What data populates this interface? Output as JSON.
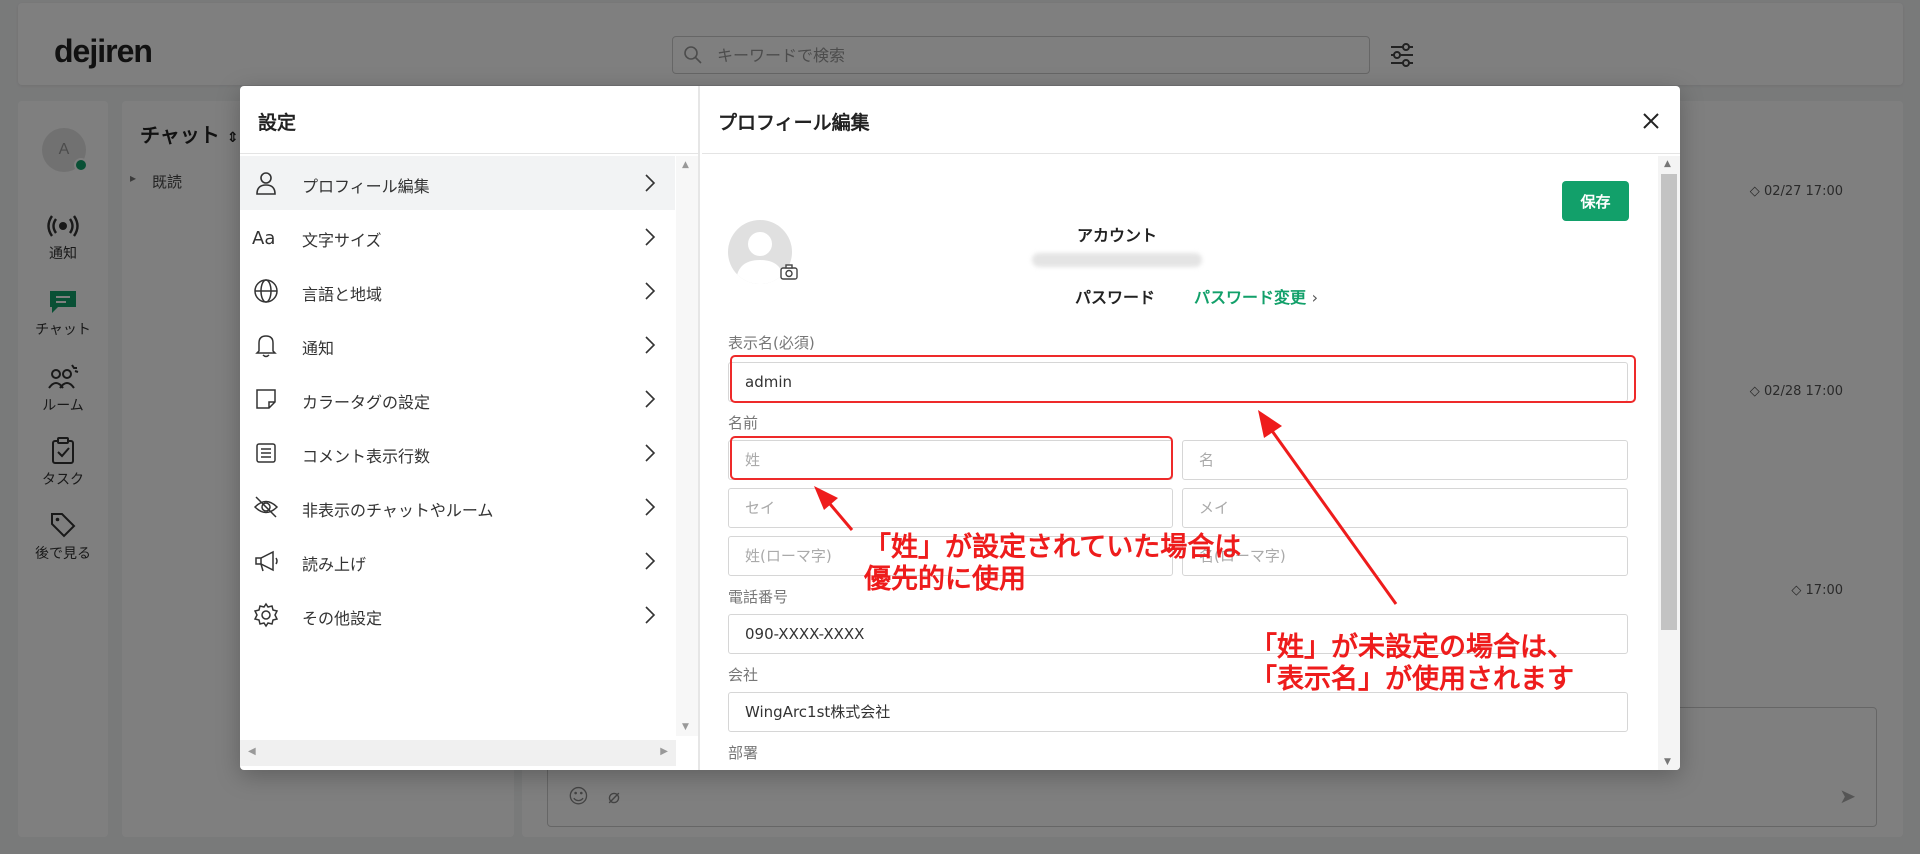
{
  "app": {
    "logo": "dejiren",
    "search_placeholder": "キーワードで検索"
  },
  "sidenav": {
    "avatar_initial": "A",
    "items": [
      {
        "label": "通知",
        "icon": "broadcast-icon"
      },
      {
        "label": "チャット",
        "icon": "chat-icon"
      },
      {
        "label": "ルーム",
        "icon": "room-icon"
      },
      {
        "label": "タスク",
        "icon": "task-icon"
      },
      {
        "label": "後で見る",
        "icon": "tag-icon"
      }
    ]
  },
  "chatlist": {
    "title": "チャット",
    "section": "既読"
  },
  "mainpane": {
    "timestamps": [
      "02/27 17:00",
      "02/28 17:00",
      "17:00"
    ]
  },
  "modal": {
    "left_title": "設定",
    "menu": [
      {
        "label": "プロフィール編集",
        "icon": "person-icon",
        "active": true
      },
      {
        "label": "文字サイズ",
        "icon": "font-size-icon",
        "active": false
      },
      {
        "label": "言語と地域",
        "icon": "globe-icon",
        "active": false
      },
      {
        "label": "通知",
        "icon": "bell-icon",
        "active": false
      },
      {
        "label": "カラータグの設定",
        "icon": "color-tag-icon",
        "active": false
      },
      {
        "label": "コメント表示行数",
        "icon": "comment-lines-icon",
        "active": false
      },
      {
        "label": "非表示のチャットやルーム",
        "icon": "eye-off-icon",
        "active": false
      },
      {
        "label": "読み上げ",
        "icon": "megaphone-icon",
        "active": false
      },
      {
        "label": "その他設定",
        "icon": "gear-icon",
        "active": false
      }
    ],
    "right_title": "プロフィール編集",
    "save_label": "保存",
    "account_label": "アカウント",
    "password_label": "パスワード",
    "password_change_label": "パスワード変更",
    "display_name_label": "表示名(必須)",
    "display_name_value": "admin",
    "name_label": "名前",
    "last_name_placeholder": "姓",
    "first_name_placeholder": "名",
    "last_kana_placeholder": "セイ",
    "first_kana_placeholder": "メイ",
    "last_roman_placeholder": "姓(ローマ字)",
    "first_roman_placeholder": "名(ローマ字)",
    "phone_label": "電話番号",
    "phone_value": "090-XXXX-XXXX",
    "company_label": "会社",
    "company_value": "WingArc1st株式会社",
    "department_label": "部署"
  },
  "annotations": {
    "note1_line1": "「姓」が設定されていた場合は",
    "note1_line2": "優先的に使用",
    "note2_line1": "「姓」が未設定の場合は、",
    "note2_line2": "「表示名」が使用されます",
    "color": "#ee1c1c"
  }
}
